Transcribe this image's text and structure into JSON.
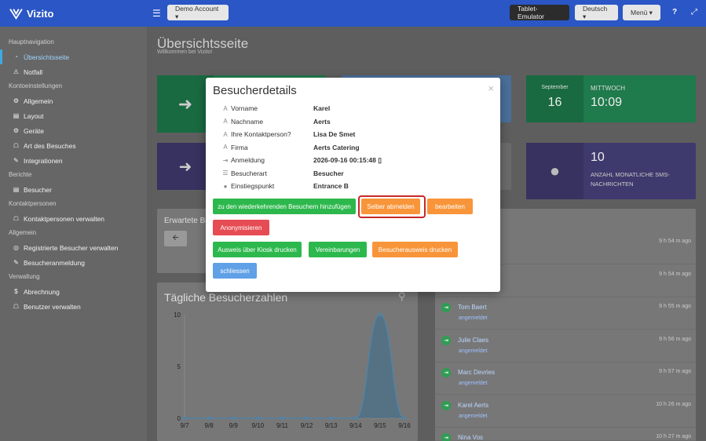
{
  "app": {
    "name": "Vizito"
  },
  "topbar": {
    "account": "Demo Account ▾",
    "tablet": "Tablet-Emulator",
    "language": "Deutsch ▾",
    "menu": "Menü ▾",
    "help_icon": "?",
    "expand_icon": "⤢"
  },
  "sidebar": {
    "sections": [
      {
        "title": "Hauptnavigation",
        "items": [
          {
            "label": "Übersichtsseite",
            "icon": "◔",
            "active": true
          },
          {
            "label": "Notfall",
            "icon": "⚠"
          }
        ]
      },
      {
        "title": "Kontoeinstellungen",
        "items": [
          {
            "label": "Allgemein",
            "icon": "⚙"
          },
          {
            "label": "Layout",
            "icon": "▤"
          },
          {
            "label": "Geräte",
            "icon": "⚙"
          },
          {
            "label": "Art des Besuches",
            "icon": "☖"
          },
          {
            "label": "Integrationen",
            "icon": "✎"
          }
        ]
      },
      {
        "title": "Berichte",
        "items": [
          {
            "label": "Besucher",
            "icon": "▤"
          }
        ]
      },
      {
        "title": "Kontaktpersonen",
        "items": [
          {
            "label": "Kontaktpersonen verwalten",
            "icon": "☖"
          }
        ]
      },
      {
        "title": "Allgemein",
        "items": [
          {
            "label": "Registrierte Besucher verwalten",
            "icon": "◎"
          },
          {
            "label": "Besucheranmeldung",
            "icon": "✎"
          }
        ]
      },
      {
        "title": "Verwaltung",
        "items": [
          {
            "label": "Abrechnung",
            "icon": "$"
          },
          {
            "label": "Benutzer verwalten",
            "icon": "☖"
          }
        ]
      }
    ]
  },
  "page": {
    "title": "Übersichtsseite",
    "subtitle": "Willkommen bei Vizito!"
  },
  "tiles": {
    "date_month": "September",
    "date_day": "16",
    "weekday": "MITTWOCH",
    "time": "10:09",
    "sms_count": "10",
    "sms_label": "ANZAHL MONATLICHE SMS-NACHRICHTEN"
  },
  "expected": {
    "title": "Erwartete Be"
  },
  "chart_data": {
    "type": "area",
    "title": "Tägliche Besucherzahlen",
    "categories": [
      "9/7",
      "9/8",
      "9/9",
      "9/10",
      "9/11",
      "9/12",
      "9/13",
      "9/14",
      "9/15",
      "9/16"
    ],
    "values": [
      0,
      0,
      0,
      0,
      0,
      0,
      0,
      0,
      10,
      0
    ],
    "yticks": [
      "10",
      "5",
      "0"
    ],
    "ylim": [
      0,
      10
    ],
    "color": "#3a6f92"
  },
  "recent": {
    "header": "en",
    "rows": [
      {
        "name": "",
        "status": "",
        "time": "9 h 54 m ago"
      },
      {
        "name": "",
        "status": "",
        "time": "9 h 54 m ago"
      },
      {
        "name": "Tom Baert",
        "status": "angemeldet",
        "time": "9 h 55 m ago"
      },
      {
        "name": "Julie Claes",
        "status": "angemeldet",
        "time": "9 h 56 m ago"
      },
      {
        "name": "Marc Devries",
        "status": "angemeldet",
        "time": "9 h 57 m ago"
      },
      {
        "name": "Karel Aerts",
        "status": "angemeldet",
        "time": "10 h 26 m ago"
      },
      {
        "name": "Nina Vos",
        "status": "",
        "time": "10 h 27 m ago"
      }
    ]
  },
  "modal": {
    "title": "Besucherdetails",
    "close": "×",
    "fields": [
      {
        "icon": "A",
        "label": "Vorname",
        "value": "Karel"
      },
      {
        "icon": "A",
        "label": "Nachname",
        "value": "Aerts"
      },
      {
        "icon": "A",
        "label": "Ihre Kontaktperson?",
        "value": "Lisa De Smet"
      },
      {
        "icon": "A",
        "label": "Firma",
        "value": "Aerts Catering"
      },
      {
        "icon": "⇥",
        "label": "Anmeldung",
        "value": "2026-09-16 00:15:48 ▯"
      },
      {
        "icon": "☰",
        "label": "Besucherart",
        "value": "Besucher"
      },
      {
        "icon": "●",
        "label": "Einstiegspunkt",
        "value": "Entrance B"
      }
    ],
    "buttons": {
      "add_recurring": "zu den wiederkehrenden Besuchern hinzufügen",
      "self_checkout": "Selber abmelden",
      "edit": "bearbeiten",
      "anonymize": "Anonymisieren",
      "kiosk_print": "Ausweis über Kiosk drucken",
      "agreements": "Vereinbarungen",
      "badge_print": "Besucherausweis drucken",
      "close": "schliessen"
    }
  }
}
